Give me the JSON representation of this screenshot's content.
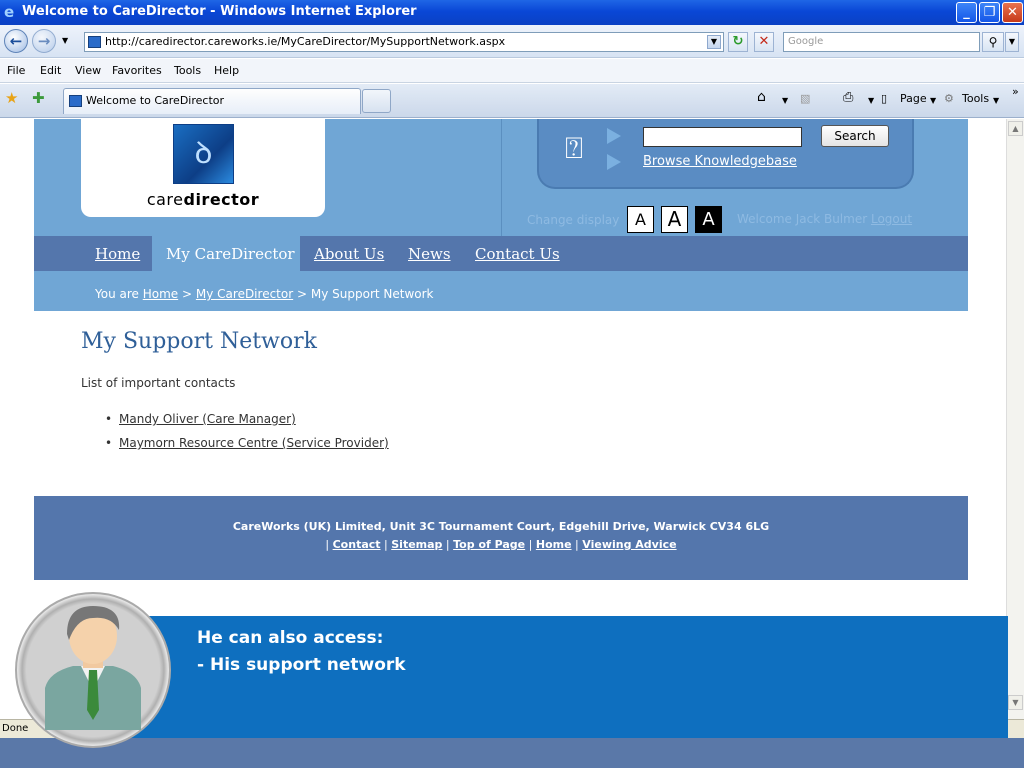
{
  "window": {
    "title": "Welcome to CareDirector - Windows Internet Explorer",
    "minimize": "_",
    "restore": "❐",
    "close": "✕"
  },
  "address_bar": {
    "url": "http://caredirector.careworks.ie/MyCareDirector/MySupportNetwork.aspx",
    "search_placeholder": "Google"
  },
  "menu": [
    "File",
    "Edit",
    "View",
    "Favorites",
    "Tools",
    "Help"
  ],
  "tab": {
    "title": "Welcome to CareDirector"
  },
  "command_bar": {
    "page_label": "Page",
    "tools_label": "Tools"
  },
  "site": {
    "logo_text_light": "care",
    "logo_text_bold": "director",
    "search_button": "Search",
    "browse_link": "Browse Knowledgebase",
    "change_display": "Change display",
    "font_size_labels": [
      "A",
      "A",
      "A"
    ],
    "welcome_text": "Welcome Jack Bulmer",
    "logout": "Logout",
    "nav": [
      "Home",
      "My CareDirector",
      "About Us",
      "News",
      "Contact Us"
    ],
    "nav_active": "My CareDirector",
    "breadcrumb": {
      "prefix": "You are",
      "links": [
        "Home",
        "My CareDirector"
      ],
      "separator": ">",
      "current": "My Support Network"
    },
    "page_title": "My Support Network",
    "list_intro": "List of important contacts",
    "contacts": [
      "Mandy Oliver (Care Manager)",
      "Maymorn Resource Centre (Service Provider)"
    ],
    "footer": {
      "address": "CareWorks (UK) Limited, Unit 3C Tournament Court, Edgehill Drive, Warwick CV34 6LG",
      "links": [
        "Contact",
        "Sitemap",
        "Top of Page",
        "Home",
        "Viewing Advice"
      ],
      "separator": "|"
    }
  },
  "status_bar": {
    "text": "Done"
  },
  "overlay": {
    "line1": "He can also access:",
    "line2": "- His support network"
  },
  "colors": {
    "header_blue": "#70a6d5",
    "nav_blue": "#5476ac",
    "title_blue": "#2f5f98",
    "banner_blue": "#0e6fbf"
  }
}
